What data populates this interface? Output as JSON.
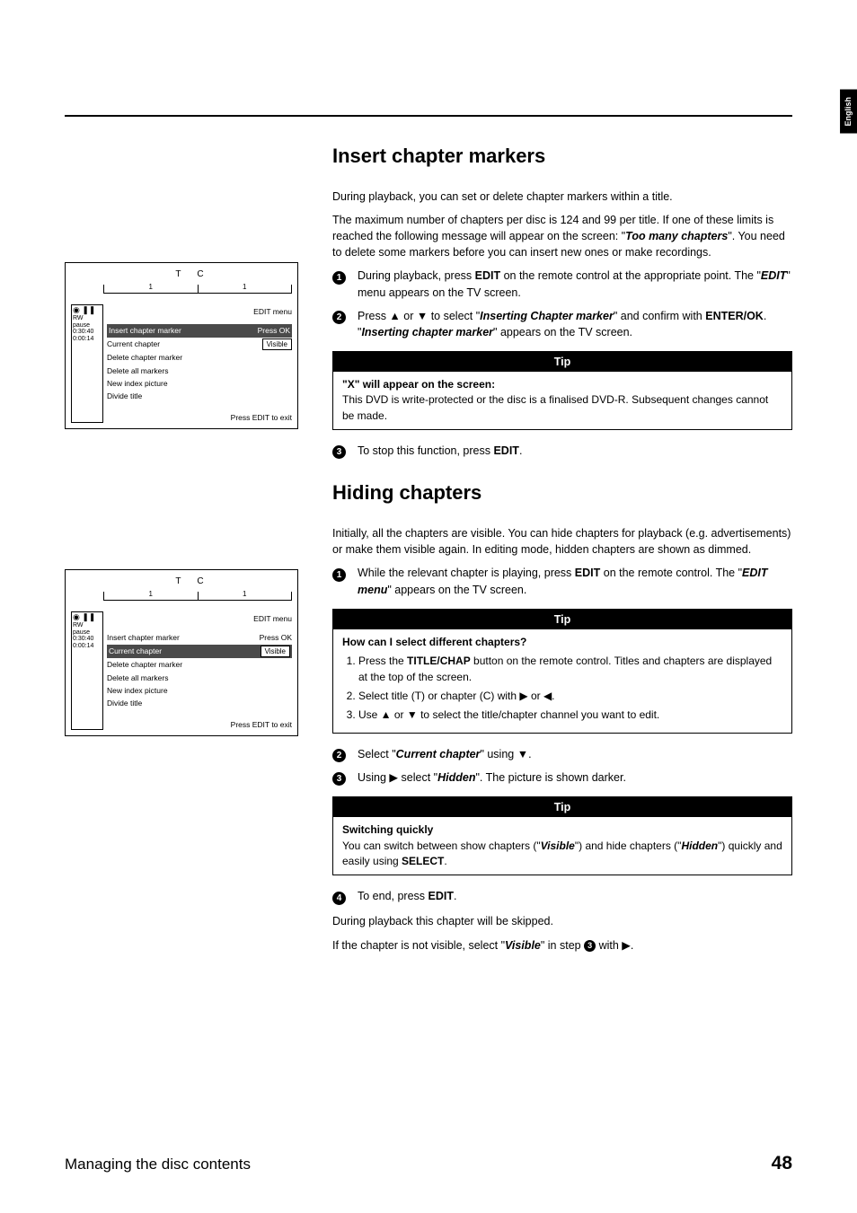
{
  "language_tab": "English",
  "section1": {
    "heading": "Insert chapter markers",
    "intro_p1": "During playback, you can set or delete chapter markers within a title.",
    "intro_p2_a": "The maximum number of chapters per disc is 124 and 99 per title. If one of these limits is reached the following message will appear on the screen: \"",
    "intro_p2_b": "Too many chapters",
    "intro_p2_c": "\". You need to delete some markers before you can insert new ones or make recordings.",
    "step1_a": "During playback, press ",
    "step1_b": "EDIT",
    "step1_c": " on the remote control at the appropriate point. The \"",
    "step1_d": "EDIT",
    "step1_e": "\" menu appears on the TV screen.",
    "step2_a": "Press ▲ or ▼ to select \"",
    "step2_b": "Inserting Chapter marker",
    "step2_c": "\" and confirm with ",
    "step2_d": "ENTER/OK",
    "step2_e": ". \"",
    "step2_f": "Inserting chapter marker",
    "step2_g": "\" appears on the TV screen.",
    "tip_label": "Tip",
    "tip_h": "\"X\" will appear on the screen:",
    "tip_body": "This DVD is write-protected or the disc is a finalised DVD-R. Subsequent changes cannot be made.",
    "step3_a": "To stop this function, press ",
    "step3_b": "EDIT",
    "step3_c": "."
  },
  "section2": {
    "heading": "Hiding chapters",
    "intro": "Initially, all the chapters are visible. You can hide chapters for playback (e.g. advertisements) or make them visible again. In editing mode, hidden chapters are shown as dimmed.",
    "step1_a": "While the relevant chapter is playing, press ",
    "step1_b": "EDIT",
    "step1_c": " on the remote control. The \"",
    "step1_d": "EDIT menu",
    "step1_e": "\" appears on the TV screen.",
    "tip1_label": "Tip",
    "tip1_q": "How can I select different chapters?",
    "tip1_li1_a": "Press the ",
    "tip1_li1_b": "TITLE/CHAP",
    "tip1_li1_c": " button on the remote control. Titles and chapters are displayed at the top of the screen.",
    "tip1_li2": "Select title (T) or chapter (C) with ▶ or ◀.",
    "tip1_li3": "Use ▲ or ▼ to select the title/chapter channel you want to edit.",
    "step2_a": "Select \"",
    "step2_b": "Current chapter",
    "step2_c": "\" using ▼.",
    "step3_a": "Using ▶ select \"",
    "step3_b": "Hidden",
    "step3_c": "\". The picture is shown darker.",
    "tip2_label": "Tip",
    "tip2_h": "Switching quickly",
    "tip2_a": "You can switch between show chapters (\"",
    "tip2_b": "Visible",
    "tip2_c": "\") and hide chapters (\"",
    "tip2_d": "Hidden",
    "tip2_e": "\") quickly and easily using ",
    "tip2_f": "SELECT",
    "tip2_g": ".",
    "step4_a": "To end, press ",
    "step4_b": "EDIT",
    "step4_c": ".",
    "outro1": "During playback this chapter will be skipped.",
    "outro2_a": "If the chapter is not visible, select \"",
    "outro2_b": "Visible",
    "outro2_c": "\" in step ",
    "outro2_d": " with ▶."
  },
  "osd": {
    "tc": "TC",
    "t_num": "1",
    "c_num": "1",
    "status_sym": "◉ ❚❚",
    "status_txt1": "RW pause",
    "status_txt2": "0:30:40",
    "status_txt3": "0:00:14",
    "menu_title": "EDIT menu",
    "items": [
      {
        "label": "Insert chapter marker",
        "opt": "Press OK"
      },
      {
        "label": "Current chapter",
        "opt": "Visible"
      },
      {
        "label": "Delete chapter marker",
        "opt": ""
      },
      {
        "label": "Delete all markers",
        "opt": ""
      },
      {
        "label": "New index picture",
        "opt": ""
      },
      {
        "label": "Divide title",
        "opt": ""
      }
    ],
    "footer": "Press EDIT to exit"
  },
  "footer": {
    "title": "Managing the disc contents",
    "page": "48"
  }
}
